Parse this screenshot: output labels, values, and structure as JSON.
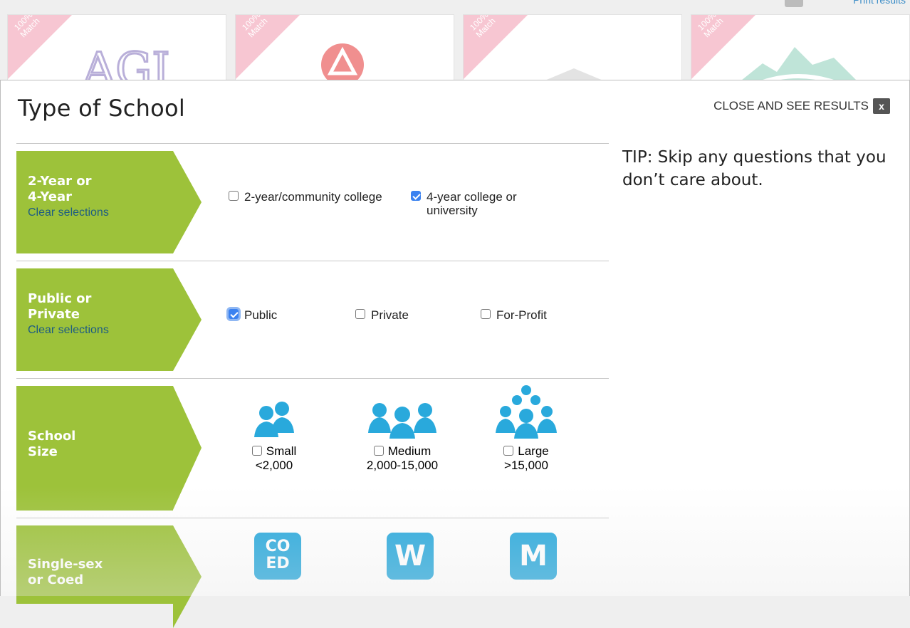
{
  "background": {
    "ribbon_text": "100%\nMatch",
    "print_link": "Print results",
    "cards": [
      {
        "logo_text": "AGI",
        "logo_icon": "ornate-letters-logo"
      },
      {
        "logo_text": "",
        "logo_icon": "triangle-circle-logo"
      },
      {
        "logo_text": "",
        "logo_icon": "columned-building-logo"
      },
      {
        "logo_text": "",
        "logo_icon": "mountain-wave-logo"
      }
    ]
  },
  "modal": {
    "title": "Type of School",
    "close_label": "CLOSE AND SEE RESULTS",
    "close_icon_label": "x",
    "tip": "TIP: Skip any questions that you don’t care about.",
    "questions": [
      {
        "title_line1": "2-Year or",
        "title_line2": "4-Year",
        "clear_label": "Clear selections",
        "options": [
          {
            "label": "2-year/community college",
            "checked": false
          },
          {
            "label": "4-year college or university",
            "checked": true
          }
        ]
      },
      {
        "title_line1": "Public or",
        "title_line2": "Private",
        "clear_label": "Clear selections",
        "options": [
          {
            "label": "Public",
            "checked": true
          },
          {
            "label": "Private",
            "checked": false
          },
          {
            "label": "For-Profit",
            "checked": false
          }
        ]
      },
      {
        "title_line1": "School",
        "title_line2": "Size",
        "options": [
          {
            "label": "Small",
            "range": "<2,000",
            "icon": "two-people-icon",
            "checked": false
          },
          {
            "label": "Medium",
            "range": "2,000-15,000",
            "icon": "three-people-icon",
            "checked": false
          },
          {
            "label": "Large",
            "range": ">15,000",
            "icon": "crowd-icon",
            "checked": false
          }
        ]
      },
      {
        "title_line1": "Single-sex",
        "title_line2": "or Coed",
        "badges": [
          {
            "line1": "CO",
            "line2": "ED"
          },
          {
            "line1": "W",
            "line2": ""
          },
          {
            "line1": "M",
            "line2": ""
          }
        ]
      }
    ],
    "colors": {
      "label_green": "#9dc23a",
      "icon_blue": "#29a9dc",
      "ribbon_pink": "#f7c6d2",
      "link_blue": "#1e5d82",
      "checkbox_blue": "#3b82f0"
    }
  }
}
